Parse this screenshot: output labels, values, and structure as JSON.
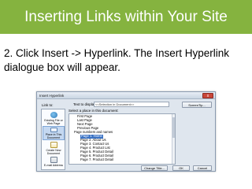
{
  "slide": {
    "title": "Inserting Links within Your Site",
    "instruction": "2. Click Insert -> Hyperlink. The Insert Hyperlink dialogue box will appear."
  },
  "colors": {
    "title_bar": "#85b33f",
    "selection": "#3a72c4"
  },
  "dialog": {
    "title": "Insert Hyperlink",
    "close_label": "x",
    "link_to_label": "Link to:",
    "text_to_display_label": "Text to display:",
    "text_to_display_value": "<<Selection in Document>>",
    "screentip_label": "ScreenTip...",
    "tree_label": "Select a place in this document:",
    "nav": [
      {
        "label": "Existing File or Web Page",
        "icon": "globe-icon"
      },
      {
        "label": "Place in This Document",
        "icon": "document-icon"
      },
      {
        "label": "Create New Document",
        "icon": "new-document-icon"
      },
      {
        "label": "E-mail Address",
        "icon": "email-icon"
      }
    ],
    "tree": [
      "First Page",
      "Last Page",
      "Next Page",
      "Previous Page",
      "Page numbers and names",
      "Page 1. Home",
      "Page 2. About Us",
      "Page 3. Contact Us",
      "Page 4. Product List",
      "Page 5. Product Detail",
      "Page 6. Product Detail",
      "Page 7. Product Detail"
    ],
    "change_title_label": "Change Title...",
    "ok_label": "OK",
    "cancel_label": "Cancel"
  }
}
